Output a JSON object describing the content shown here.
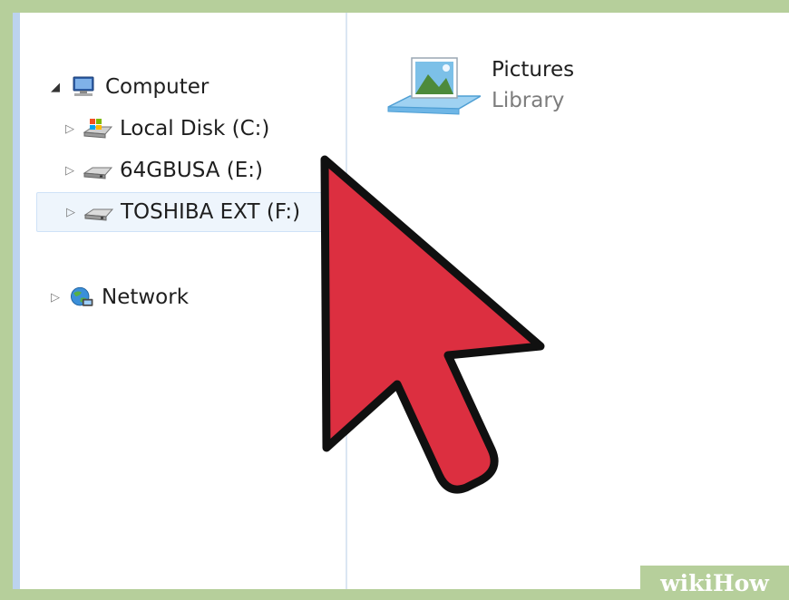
{
  "navigation_tree": {
    "computer": {
      "label": "Computer",
      "expanded": true,
      "icon": "computer-icon"
    },
    "drives": [
      {
        "label": "Local Disk (C:)",
        "icon": "local-disk-icon",
        "selected": false
      },
      {
        "label": "64GBUSA (E:)",
        "icon": "removable-drive-icon",
        "selected": false
      },
      {
        "label": "TOSHIBA EXT (F:)",
        "icon": "external-drive-icon",
        "selected": true
      }
    ],
    "network": {
      "label": "Network",
      "icon": "network-icon"
    }
  },
  "content": {
    "library_item": {
      "name": "Pictures",
      "type": "Library",
      "icon": "pictures-library-icon"
    }
  },
  "overlay": {
    "cursor": "red-arrow-cursor",
    "cursor_color": "#dc2f40"
  },
  "watermark": {
    "part1": "wiki",
    "part2": "How"
  },
  "colors": {
    "frame_green": "#b6cf9b",
    "selection": "#eef5fc",
    "rail_blue": "#bcd3ee"
  }
}
